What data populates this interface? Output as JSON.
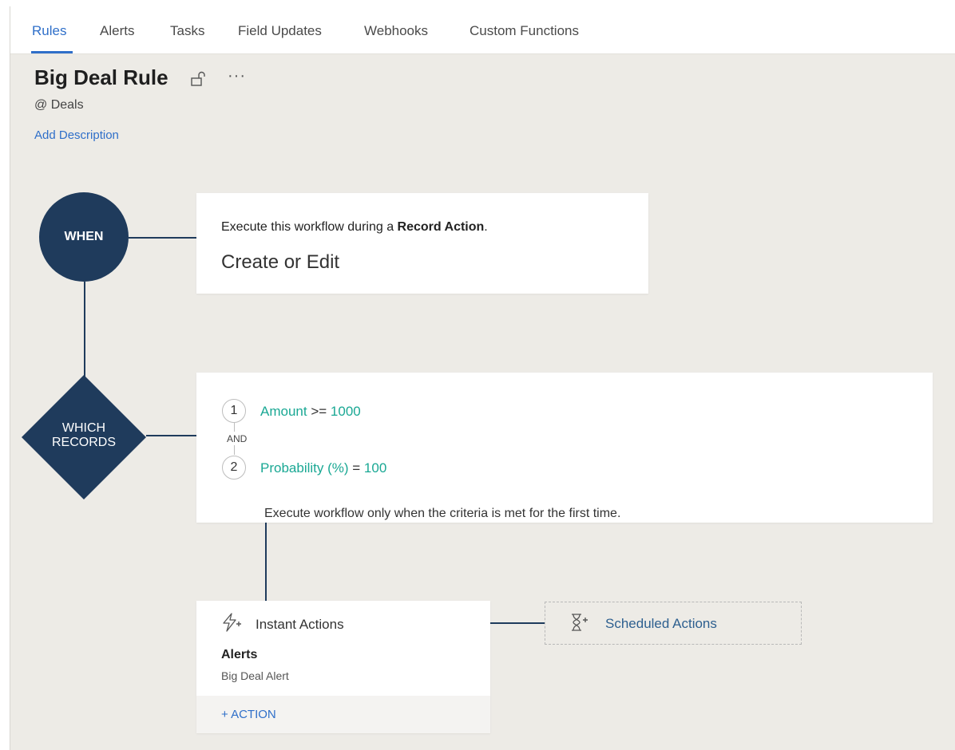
{
  "tabs": [
    {
      "label": "Rules",
      "active": true
    },
    {
      "label": "Alerts"
    },
    {
      "label": "Tasks"
    },
    {
      "label": "Field Updates"
    },
    {
      "label": "Webhooks"
    },
    {
      "label": "Custom Functions"
    }
  ],
  "rule": {
    "title": "Big Deal Rule",
    "module": "@ Deals",
    "add_description": "Add Description",
    "more_label": "···"
  },
  "when": {
    "node_label": "WHEN",
    "sentence_prefix": "Execute this workflow during a ",
    "sentence_bold": "Record Action",
    "sentence_suffix": ".",
    "action": "Create or Edit"
  },
  "which": {
    "node_label_line1": "WHICH",
    "node_label_line2": "RECORDS",
    "criteria": [
      {
        "num": "1",
        "field": "Amount",
        "op": " >= ",
        "value": "1000"
      },
      {
        "num": "2",
        "field": "Probability (%)",
        "op": " = ",
        "value": "100"
      }
    ],
    "join": "AND",
    "note": "Execute workflow only when the criteria is met for the first time."
  },
  "instant_actions": {
    "title": "Instant Actions",
    "group_label": "Alerts",
    "item": "Big Deal Alert",
    "add_action": "+ ACTION"
  },
  "scheduled_actions": {
    "title": "Scheduled Actions"
  },
  "colors": {
    "accent": "#2f6fc9",
    "node_navy": "#1f3b5c",
    "criteria_teal": "#1aa894",
    "canvas": "#edebe6"
  }
}
